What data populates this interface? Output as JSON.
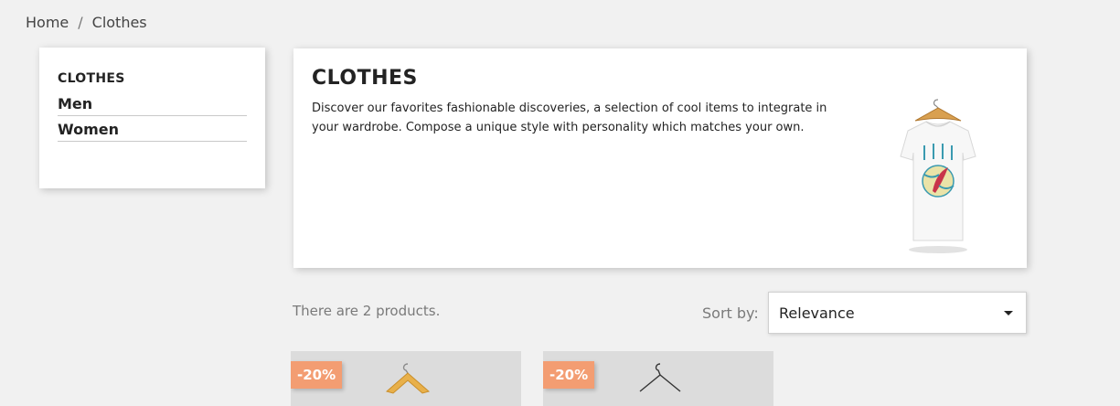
{
  "breadcrumb": {
    "home": "Home",
    "separator": "/",
    "current": "Clothes"
  },
  "sidebar": {
    "title": "CLOTHES",
    "items": [
      {
        "label": "Men"
      },
      {
        "label": "Women"
      }
    ]
  },
  "category": {
    "title": "CLOTHES",
    "description": "Discover our favorites fashionable discoveries, a selection of cool items to integrate in your wardrobe. Compose a unique style with personality which matches your own.",
    "image_icon": "tshirt-icon"
  },
  "listing": {
    "products_count_text": "There are 2 products.",
    "sort_label": "Sort by:",
    "sort_value": "Relevance"
  },
  "products": [
    {
      "discount_badge": "-20%",
      "image_icon": "wooden-hanger-icon"
    },
    {
      "discount_badge": "-20%",
      "image_icon": "wire-hanger-icon"
    }
  ],
  "colors": {
    "badge": "#f39d72",
    "background": "#f1f1f1"
  }
}
